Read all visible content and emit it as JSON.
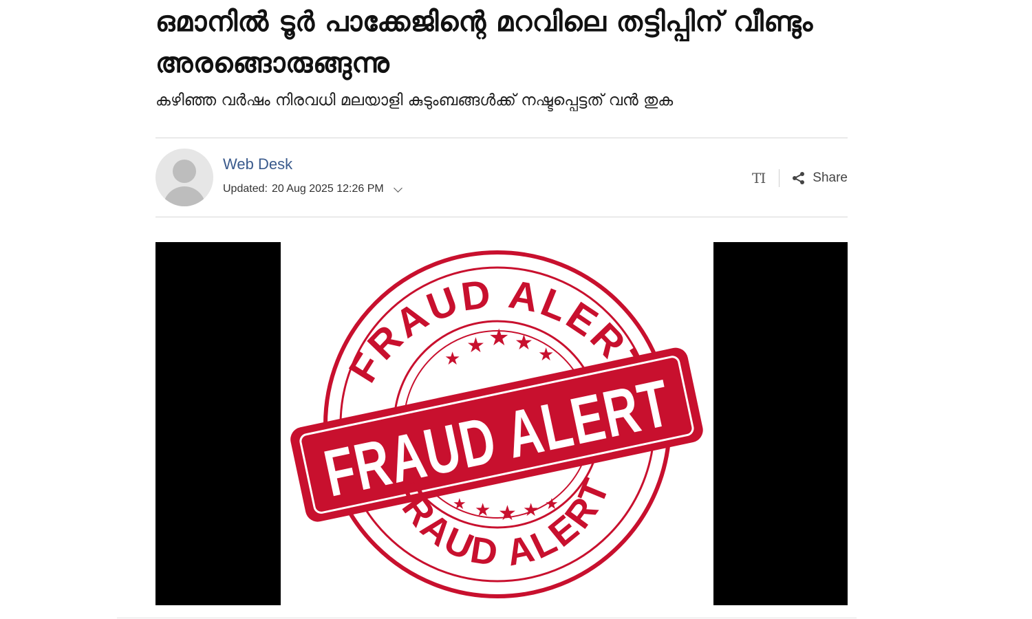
{
  "article": {
    "headline": "ഒമാനിൽ ടൂർ പാക്കേജിന്റെ മറവിലെ തട്ടിപ്പിന് വീണ്ടും അരങ്ങൊരുങ്ങുന്നു",
    "subheadline": "കഴിഞ്ഞ വർഷം നിരവധി മലയാളി കുടുംബങ്ങൾക്ക് നഷ്ടപ്പെട്ടത് വൻ തുക"
  },
  "byline": {
    "author": "Web Desk",
    "updated_label": "Updated:",
    "updated_value": "20 Aug 2025 12:26 PM"
  },
  "tools": {
    "text_size_label": "TI",
    "share_label": "Share"
  },
  "image": {
    "stamp_top_text": "FRAUD ALERT",
    "stamp_banner_text": "FRAUD ALERT",
    "stamp_bottom_text": "FRAUD ALERT",
    "stamp_color": "#c8102e"
  },
  "icons": {
    "avatar": "default-user-avatar-icon",
    "chevron": "chevron-down-icon",
    "share": "share-icon"
  }
}
